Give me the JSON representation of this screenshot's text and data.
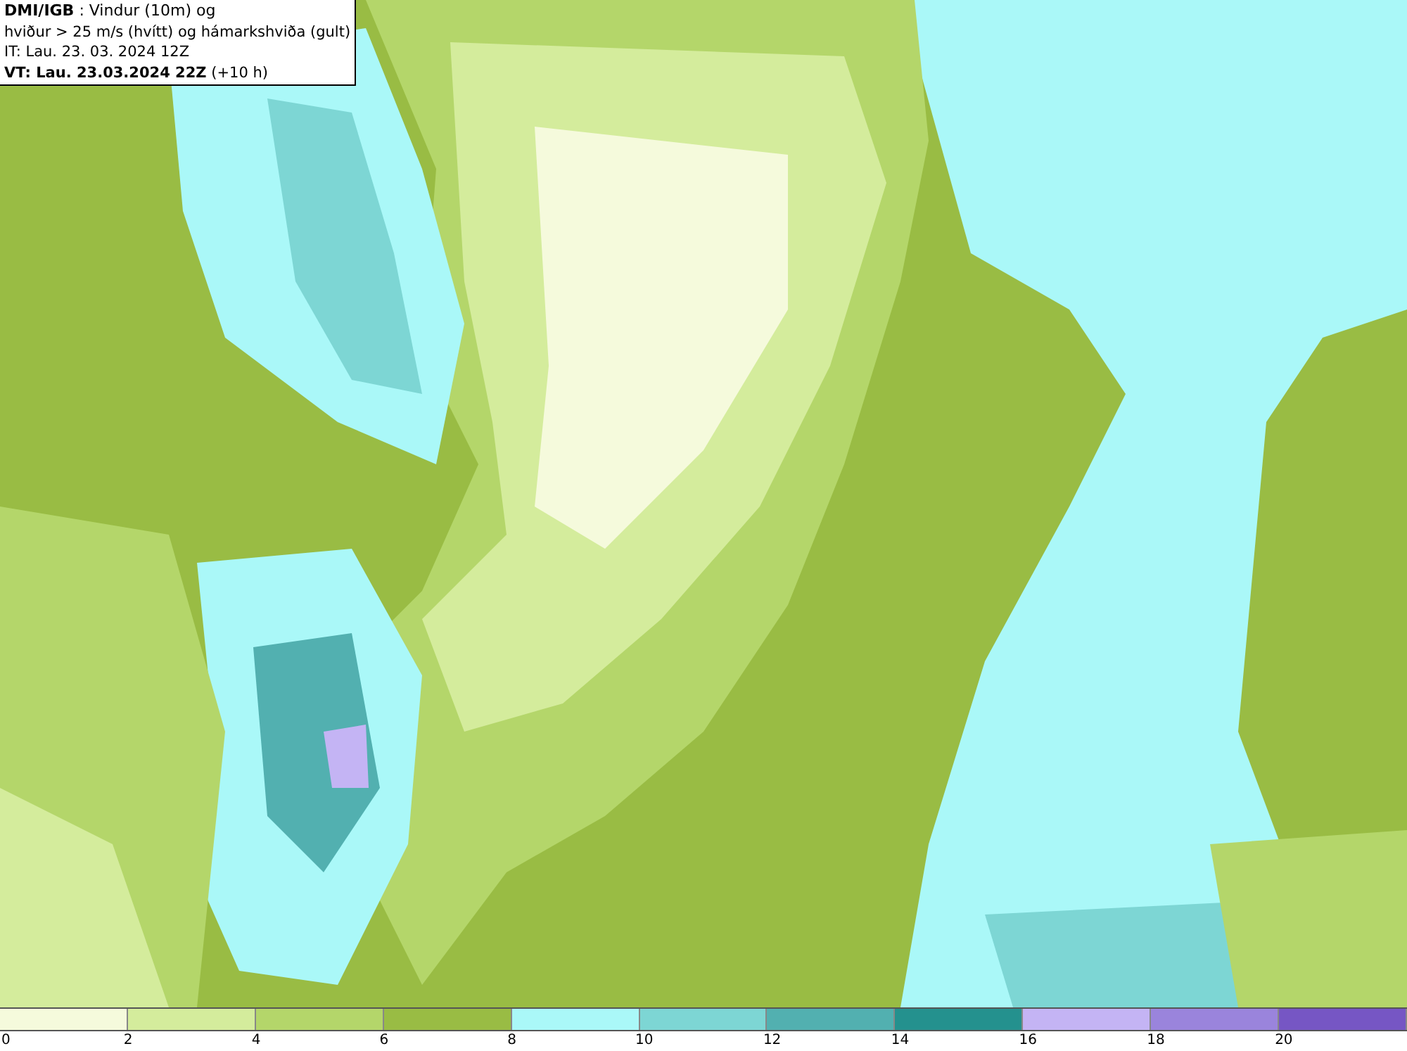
{
  "info_box": {
    "lines": [
      "**DMI/IGB** : Vindur (10m) og",
      "hviður > 25 m/s (hvítt) og hámarkshviða (gult)",
      "IT: Lau. 23. 03. 2024 12Z",
      "**VT: Lau. 23.03.2024 22Z** (+10 h)"
    ]
  },
  "color_scale": [
    {
      "label": "0",
      "color": "#f5fadc"
    },
    {
      "label": "2",
      "color": "#d4ec9c"
    },
    {
      "label": "4",
      "color": "#b4d66a"
    },
    {
      "label": "6",
      "color": "#99bc44"
    },
    {
      "label": "8",
      "color": "#aaf8f8"
    },
    {
      "label": "10",
      "color": "#7dd6d4"
    },
    {
      "label": "12",
      "color": "#52b0b0"
    },
    {
      "label": "14",
      "color": "#24918e"
    },
    {
      "label": "16",
      "color": "#c4b4f4"
    },
    {
      "label": "18",
      "color": "#9a84dc"
    },
    {
      "label": "20",
      "color": "#7656c4"
    }
  ]
}
